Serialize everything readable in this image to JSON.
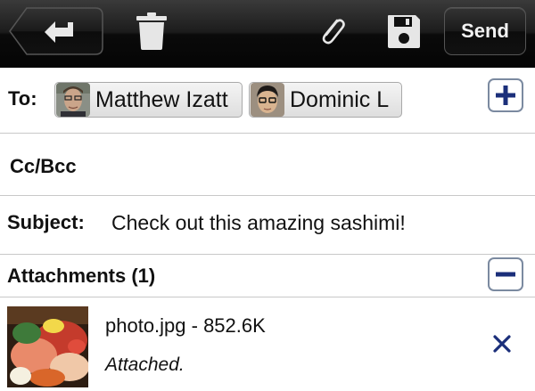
{
  "toolbar": {
    "back_icon": "back-arrow-icon",
    "trash_icon": "trash-icon",
    "attach_icon": "paperclip-icon",
    "save_icon": "floppy-disk-icon",
    "send_label": "Send"
  },
  "to": {
    "label": "To:",
    "recipients": [
      {
        "name": "Matthew Izatt",
        "avatar": "avatar-matthew"
      },
      {
        "name": "Dominic L",
        "avatar": "avatar-dominic"
      }
    ],
    "add_icon": "plus-icon"
  },
  "cc": {
    "label": "Cc/Bcc"
  },
  "subject": {
    "label": "Subject:",
    "value": "Check out this amazing sashimi!"
  },
  "attachments": {
    "label": "Attachments (1)",
    "collapse_icon": "minus-icon",
    "items": [
      {
        "name": "photo.jpg - 852.6K",
        "status": "Attached.",
        "remove_icon": "close-x-icon"
      }
    ]
  },
  "colors": {
    "toolbar_dark": "#111111",
    "accent_blue": "#1b2f7a",
    "divider": "#c8c8c8"
  }
}
